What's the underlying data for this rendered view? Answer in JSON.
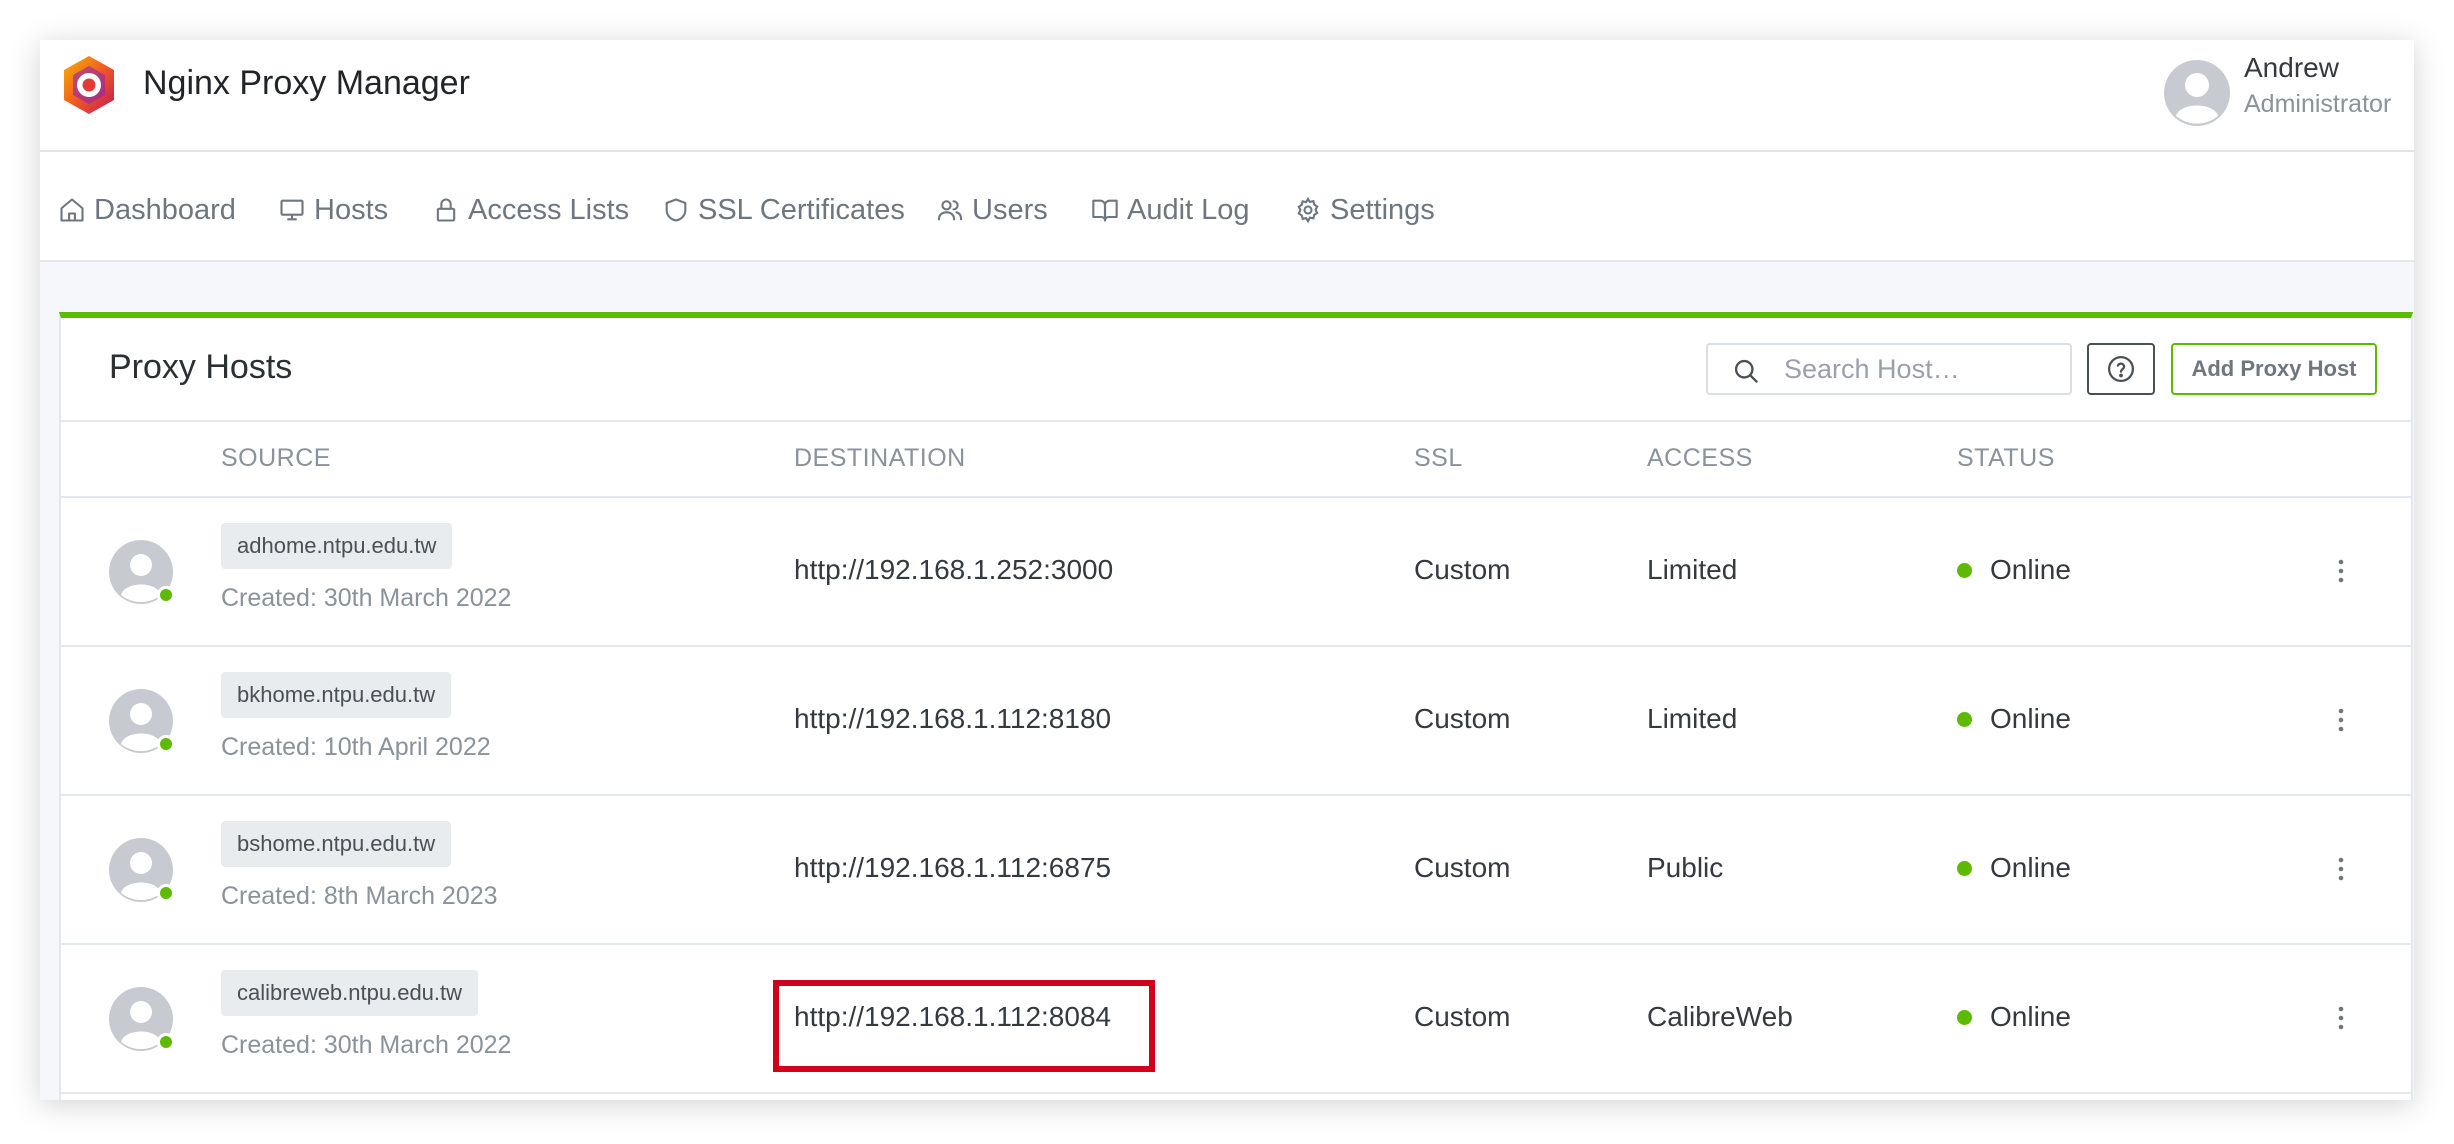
{
  "app": {
    "title": "Nginx Proxy Manager",
    "logo_icon": "nginx-proxy-manager-logo"
  },
  "user": {
    "name": "Andrew",
    "role": "Administrator",
    "avatar_icon": "user-avatar-icon"
  },
  "nav": {
    "items": [
      {
        "label": "Dashboard",
        "icon": "home-icon"
      },
      {
        "label": "Hosts",
        "icon": "monitor-icon"
      },
      {
        "label": "Access Lists",
        "icon": "lock-icon"
      },
      {
        "label": "SSL Certificates",
        "icon": "shield-icon"
      },
      {
        "label": "Users",
        "icon": "users-icon"
      },
      {
        "label": "Audit Log",
        "icon": "book-icon"
      },
      {
        "label": "Settings",
        "icon": "gear-icon"
      }
    ]
  },
  "card": {
    "title": "Proxy Hosts",
    "search_placeholder": "Search Host…",
    "help_icon": "question-circle-icon",
    "add_button": "Add Proxy Host",
    "accent_color": "#5eba00"
  },
  "table": {
    "columns": [
      "SOURCE",
      "DESTINATION",
      "SSL",
      "ACCESS",
      "STATUS"
    ],
    "rows": [
      {
        "domain": "adhome.ntpu.edu.tw",
        "created": "Created: 30th March 2022",
        "destination": "http://192.168.1.252:3000",
        "ssl": "Custom",
        "access": "Limited",
        "status": "Online"
      },
      {
        "domain": "bkhome.ntpu.edu.tw",
        "created": "Created: 10th April 2022",
        "destination": "http://192.168.1.112:8180",
        "ssl": "Custom",
        "access": "Limited",
        "status": "Online"
      },
      {
        "domain": "bshome.ntpu.edu.tw",
        "created": "Created: 8th March 2023",
        "destination": "http://192.168.1.112:6875",
        "ssl": "Custom",
        "access": "Public",
        "status": "Online"
      },
      {
        "domain": "calibreweb.ntpu.edu.tw",
        "created": "Created: 30th March 2022",
        "destination": "http://192.168.1.112:8084",
        "ssl": "Custom",
        "access": "CalibreWeb",
        "status": "Online"
      }
    ]
  },
  "colors": {
    "online": "#5eba00",
    "highlight": "#d0021b"
  }
}
